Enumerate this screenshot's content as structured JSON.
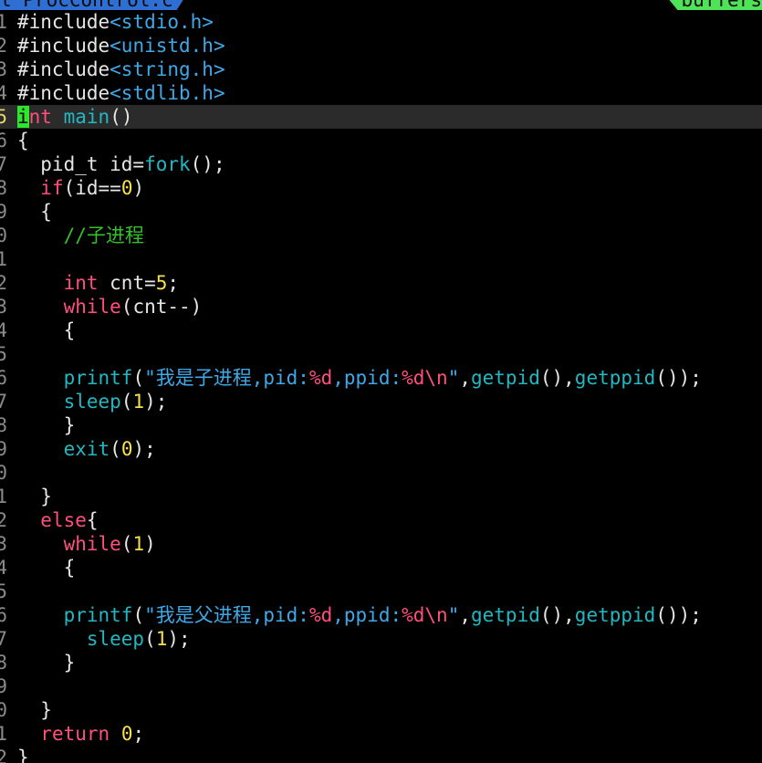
{
  "tabs": {
    "active_file": "l ProcControl.c",
    "buffers_label": "buffers"
  },
  "theme": {
    "keyword": "#ff4f7a",
    "function": "#21b8c2",
    "number": "#f5e24a",
    "string": "#3fa8e8",
    "comment": "#33c02a",
    "cursor": "#2ee62e",
    "current_line_bg": "#2b2b2b"
  },
  "lines": [
    {
      "n": "1",
      "t": [
        [
          "pre",
          "#include"
        ],
        [
          "inc",
          "<stdio.h>"
        ]
      ]
    },
    {
      "n": "2",
      "t": [
        [
          "pre",
          "#include"
        ],
        [
          "inc",
          "<unistd.h>"
        ]
      ]
    },
    {
      "n": "3",
      "t": [
        [
          "pre",
          "#include"
        ],
        [
          "inc",
          "<string.h>"
        ]
      ]
    },
    {
      "n": "4",
      "t": [
        [
          "pre",
          "#include"
        ],
        [
          "inc",
          "<stdlib.h>"
        ]
      ]
    },
    {
      "n": "5",
      "current": true,
      "t": [
        [
          "cursor",
          "i"
        ],
        [
          "kw",
          "nt"
        ],
        [
          "txt",
          " "
        ],
        [
          "fn",
          "main"
        ],
        [
          "txt",
          "()"
        ]
      ]
    },
    {
      "n": "6",
      "t": [
        [
          "txt",
          "{"
        ]
      ]
    },
    {
      "n": "7",
      "t": [
        [
          "txt",
          "  pid_t id="
        ],
        [
          "fn",
          "fork"
        ],
        [
          "txt",
          "();"
        ]
      ]
    },
    {
      "n": "8",
      "t": [
        [
          "txt",
          "  "
        ],
        [
          "kw",
          "if"
        ],
        [
          "txt",
          "(id=="
        ],
        [
          "num",
          "0"
        ],
        [
          "txt",
          ")"
        ]
      ]
    },
    {
      "n": "9",
      "t": [
        [
          "txt",
          "  {"
        ]
      ]
    },
    {
      "n": "0",
      "t": [
        [
          "txt",
          "    "
        ],
        [
          "cmt",
          "//子进程"
        ]
      ]
    },
    {
      "n": "1",
      "t": []
    },
    {
      "n": "2",
      "t": [
        [
          "txt",
          "    "
        ],
        [
          "kw",
          "int"
        ],
        [
          "txt",
          " cnt="
        ],
        [
          "num",
          "5"
        ],
        [
          "txt",
          ";"
        ]
      ]
    },
    {
      "n": "3",
      "t": [
        [
          "txt",
          "    "
        ],
        [
          "kw",
          "while"
        ],
        [
          "txt",
          "(cnt--)"
        ]
      ]
    },
    {
      "n": "4",
      "t": [
        [
          "txt",
          "    {"
        ]
      ]
    },
    {
      "n": "5",
      "t": []
    },
    {
      "n": "6",
      "t": [
        [
          "txt",
          "    "
        ],
        [
          "fn",
          "printf"
        ],
        [
          "txt",
          "("
        ],
        [
          "str",
          "\"我是子进程,pid:"
        ],
        [
          "fmt",
          "%d"
        ],
        [
          "str",
          ",ppid:"
        ],
        [
          "fmt",
          "%d\\n"
        ],
        [
          "str",
          "\""
        ],
        [
          "txt",
          ","
        ],
        [
          "fn",
          "getpid"
        ],
        [
          "txt",
          "(),"
        ],
        [
          "fn",
          "getppid"
        ],
        [
          "txt",
          "());"
        ]
      ]
    },
    {
      "n": "7",
      "t": [
        [
          "txt",
          "    "
        ],
        [
          "fn",
          "sleep"
        ],
        [
          "txt",
          "("
        ],
        [
          "num",
          "1"
        ],
        [
          "txt",
          ");"
        ]
      ]
    },
    {
      "n": "8",
      "t": [
        [
          "txt",
          "    }"
        ]
      ]
    },
    {
      "n": "9",
      "t": [
        [
          "txt",
          "    "
        ],
        [
          "fn",
          "exit"
        ],
        [
          "txt",
          "("
        ],
        [
          "num",
          "0"
        ],
        [
          "txt",
          ");"
        ]
      ]
    },
    {
      "n": "0",
      "t": []
    },
    {
      "n": "1",
      "t": [
        [
          "txt",
          "  }"
        ]
      ]
    },
    {
      "n": "2",
      "t": [
        [
          "txt",
          "  "
        ],
        [
          "kw",
          "else"
        ],
        [
          "txt",
          "{"
        ]
      ]
    },
    {
      "n": "3",
      "t": [
        [
          "txt",
          "    "
        ],
        [
          "kw",
          "while"
        ],
        [
          "txt",
          "("
        ],
        [
          "num",
          "1"
        ],
        [
          "txt",
          ")"
        ]
      ]
    },
    {
      "n": "4",
      "t": [
        [
          "txt",
          "    {"
        ]
      ]
    },
    {
      "n": "5",
      "t": []
    },
    {
      "n": "6",
      "t": [
        [
          "txt",
          "    "
        ],
        [
          "fn",
          "printf"
        ],
        [
          "txt",
          "("
        ],
        [
          "str",
          "\"我是父进程,pid:"
        ],
        [
          "fmt",
          "%d"
        ],
        [
          "str",
          ",ppid:"
        ],
        [
          "fmt",
          "%d\\n"
        ],
        [
          "str",
          "\""
        ],
        [
          "txt",
          ","
        ],
        [
          "fn",
          "getpid"
        ],
        [
          "txt",
          "(),"
        ],
        [
          "fn",
          "getppid"
        ],
        [
          "txt",
          "());"
        ]
      ]
    },
    {
      "n": "7",
      "t": [
        [
          "txt",
          "      "
        ],
        [
          "fn",
          "sleep"
        ],
        [
          "txt",
          "("
        ],
        [
          "num",
          "1"
        ],
        [
          "txt",
          ");"
        ]
      ]
    },
    {
      "n": "8",
      "t": [
        [
          "txt",
          "    }"
        ]
      ]
    },
    {
      "n": "9",
      "t": []
    },
    {
      "n": "0",
      "t": [
        [
          "txt",
          "  }"
        ]
      ]
    },
    {
      "n": "1",
      "t": [
        [
          "txt",
          "  "
        ],
        [
          "kw",
          "return"
        ],
        [
          "txt",
          " "
        ],
        [
          "num",
          "0"
        ],
        [
          "txt",
          ";"
        ]
      ]
    },
    {
      "n": "2",
      "t": [
        [
          "txt",
          "}"
        ]
      ]
    }
  ]
}
